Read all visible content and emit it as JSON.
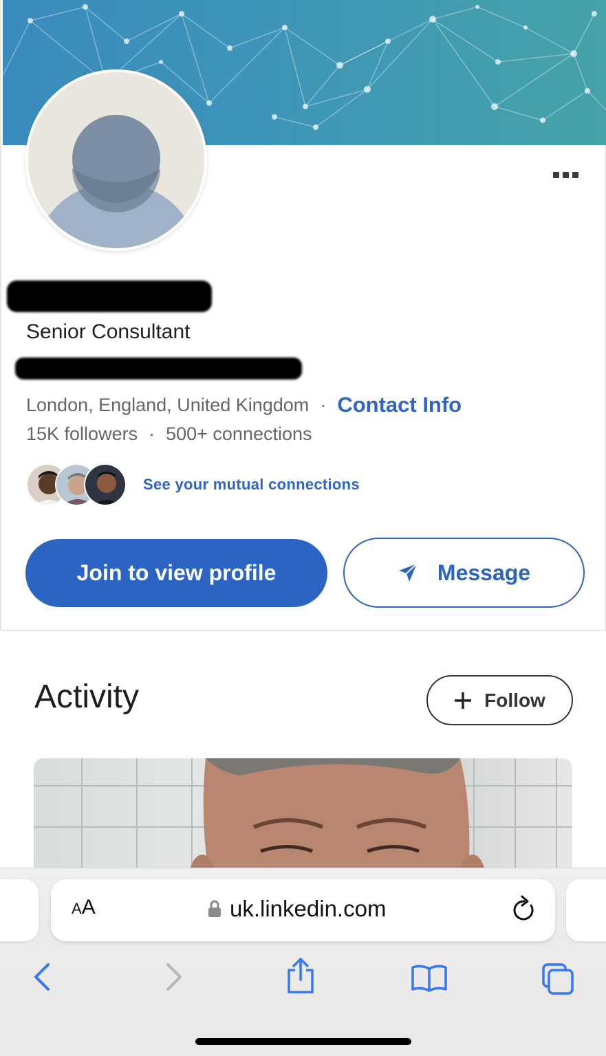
{
  "profile": {
    "headline": "Senior Consultant",
    "location": "London, England, United Kingdom",
    "separator": "·",
    "contact_info_label": "Contact Info",
    "followers": "15K followers",
    "connections": "500+ connections",
    "mutual_connections_label": "See your mutual connections",
    "join_button_label": "Join to view profile",
    "message_button_label": "Message",
    "more_icon": "more-horizontal-icon"
  },
  "activity": {
    "title": "Activity",
    "follow_button_label": "Follow"
  },
  "browser": {
    "text_size_label_small": "A",
    "text_size_label_large": "A",
    "url": "uk.linkedin.com",
    "icons": [
      "back-icon",
      "forward-icon",
      "share-icon",
      "bookmarks-icon",
      "tabs-icon",
      "lock-icon",
      "reload-icon"
    ]
  },
  "colors": {
    "brand_blue": "#2b64c3",
    "link_blue": "#2f66c4",
    "banner_teal": "#3e95b8"
  }
}
